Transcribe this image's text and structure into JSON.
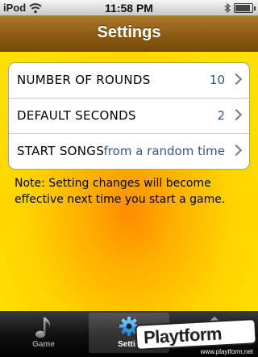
{
  "status_bar": {
    "carrier": "iPod",
    "time": "11:58 PM",
    "icons": [
      "wifi-icon",
      "bluetooth-icon",
      "battery-icon"
    ],
    "battery_level": 0.9
  },
  "nav": {
    "title": "Settings"
  },
  "settings": [
    {
      "label": "NUMBER OF ROUNDS",
      "value": "10"
    },
    {
      "label": "DEFAULT SECONDS",
      "value": "2"
    },
    {
      "label": "START SONGS",
      "value": "from a random time"
    }
  ],
  "note": "Note: Setting changes will become effective next time you start a game.",
  "tabs": [
    {
      "label": "Game",
      "icon": "music-note-icon",
      "selected": false
    },
    {
      "label": "Settin",
      "icon": "gear-icon",
      "selected": true
    },
    {
      "label": "",
      "icon": "house-icon",
      "selected": false
    }
  ],
  "watermark": {
    "logo": "Playtform",
    "url": "www.playtform.net"
  },
  "colors": {
    "nav_brown": "#8a5a14",
    "value_blue": "#385487",
    "background_yellow": "#ffd200",
    "background_orange": "#ff8c00"
  }
}
